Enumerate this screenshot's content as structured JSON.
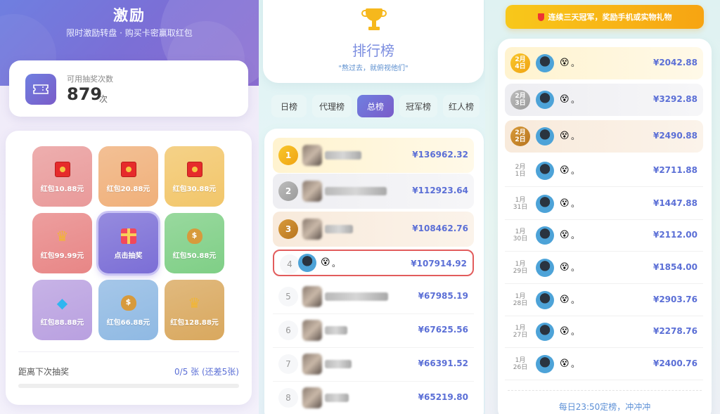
{
  "incentive": {
    "title": "激励",
    "subtitle": "限时激励转盘 · 购买卡密赢取红包",
    "draws_label": "可用抽奖次数",
    "draws_count": "879",
    "draws_unit": "次",
    "prizes": [
      {
        "label": "红包10.88元",
        "icon": "red-packet-icon",
        "bg": "#e99a9a"
      },
      {
        "label": "红包20.88元",
        "icon": "red-packet-icon",
        "bg": "#f0b07a"
      },
      {
        "label": "红包30.88元",
        "icon": "red-packet-icon",
        "bg": "#f2c66a"
      },
      {
        "label": "红包99.99元",
        "icon": "crown-icon",
        "bg": "#e88686"
      },
      {
        "label": "点击抽奖",
        "icon": "gift-icon",
        "bg": "#7b6ed6"
      },
      {
        "label": "红包50.88元",
        "icon": "money-bag-icon",
        "bg": "#7fcf86"
      },
      {
        "label": "红包88.88元",
        "icon": "diamond-icon",
        "bg": "#b9a0e0"
      },
      {
        "label": "红包66.88元",
        "icon": "money-bag-icon",
        "bg": "#8fb9e3"
      },
      {
        "label": "红包128.88元",
        "icon": "crown-icon",
        "bg": "#d9a85e"
      }
    ],
    "next_label": "距离下次抽奖",
    "next_value": "0/5 张 (还差5张)",
    "progress": 0.0
  },
  "leaderboard": {
    "title": "排行榜",
    "quote": "\"熬过去，就俯视他们\"",
    "tabs": [
      {
        "label": "日榜",
        "active": false
      },
      {
        "label": "代理榜",
        "active": false
      },
      {
        "label": "总榜",
        "active": true
      },
      {
        "label": "冠军榜",
        "active": false
      },
      {
        "label": "红人榜",
        "active": false
      }
    ],
    "rows": [
      {
        "rank": "1",
        "amount": "¥136962.32",
        "style": "gold",
        "name": ""
      },
      {
        "rank": "2",
        "amount": "¥112923.64",
        "style": "silver",
        "name": ""
      },
      {
        "rank": "3",
        "amount": "¥108462.76",
        "style": "bronze",
        "name": ""
      },
      {
        "rank": "4",
        "amount": "¥107914.92",
        "style": "hl",
        "name": "。"
      },
      {
        "rank": "5",
        "amount": "¥67985.19",
        "style": "plain",
        "name": ""
      },
      {
        "rank": "6",
        "amount": "¥67625.56",
        "style": "plain",
        "name": ""
      },
      {
        "rank": "7",
        "amount": "¥66391.52",
        "style": "plain",
        "name": ""
      },
      {
        "rank": "8",
        "amount": "¥65219.80",
        "style": "plain",
        "name": ""
      }
    ]
  },
  "champions": {
    "banner": "连续三天冠军，奖励手机或实物礼物",
    "rows": [
      {
        "month": "2月",
        "day": "4日",
        "amount": "¥2042.88",
        "style": "gold",
        "name": "。"
      },
      {
        "month": "2月",
        "day": "3日",
        "amount": "¥3292.88",
        "style": "silver",
        "name": "。"
      },
      {
        "month": "2月",
        "day": "2日",
        "amount": "¥2490.88",
        "style": "bronze",
        "name": "。"
      },
      {
        "month": "2月",
        "day": "1日",
        "amount": "¥2711.88",
        "style": "plain",
        "name": "。"
      },
      {
        "month": "1月",
        "day": "31日",
        "amount": "¥1447.88",
        "style": "plain",
        "name": "。"
      },
      {
        "month": "1月",
        "day": "30日",
        "amount": "¥2112.00",
        "style": "plain",
        "name": "。"
      },
      {
        "month": "1月",
        "day": "29日",
        "amount": "¥1854.00",
        "style": "plain",
        "name": "。"
      },
      {
        "month": "1月",
        "day": "28日",
        "amount": "¥2903.76",
        "style": "plain",
        "name": "。"
      },
      {
        "month": "1月",
        "day": "27日",
        "amount": "¥2278.76",
        "style": "plain",
        "name": "。"
      },
      {
        "month": "1月",
        "day": "26日",
        "amount": "¥2400.76",
        "style": "plain",
        "name": "。"
      }
    ],
    "footer": "每日23:50定榜，冲冲冲"
  }
}
